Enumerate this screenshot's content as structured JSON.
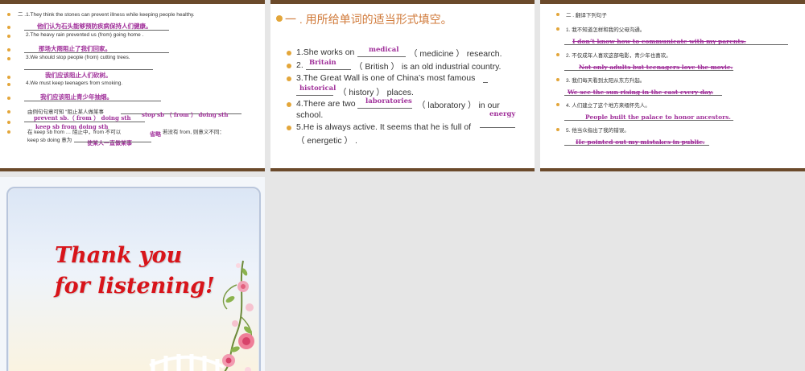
{
  "slide1": {
    "lines": [
      {
        "text": "二 .1.They think the stones can prevent illness while keeping people healthy.",
        "answer": "他们认为石头能够预防疾病保持人们健康。"
      },
      {
        "text": "2.The heavy rain prevented us (from) going home .",
        "answer": "那场大雨阻止了我们回家。"
      },
      {
        "text": "3.We should stop people (from) cutting trees.",
        "answer": "我们应该阻止人们砍树。"
      },
      {
        "text": "4.We must keep teenagers from smoking.",
        "answer": "我们应该阻止青少年抽烟。"
      }
    ],
    "note1": "由例句句意可知  “阻止某人做某事",
    "note1_ans_a": "prevent sb.（ from ）  doing sth",
    "note1_ans_b": "stop sb （ from ） doing sth",
    "note1_ans_c": "keep sb from doing sth",
    "note2": "在 keep sb from …  阻止中，from 不可以",
    "note2_ans": "省略",
    "note2_tail": "若没有 from, 则意义不同：",
    "note3": "keep sb doing  意为",
    "note3_ans": "使某人一直做某事"
  },
  "slide2": {
    "title": "一 . 用所给单词的适当形式填空。",
    "items": [
      {
        "before": "1.She works on",
        "answer": "medical",
        "after": "（ medicine ） research."
      },
      {
        "before": "2.",
        "answer": "Britain",
        "after": "（ British ） is an old industrial country."
      },
      {
        "before": "3.The Great Wall is one of China’s most famous",
        "answer": "historical",
        "after": "（ history ） places."
      },
      {
        "before": "4.There are two",
        "answer": "laboratories",
        "after": "（ laboratory ） in our",
        "after2": "school."
      },
      {
        "before": "5.He is always active. It seems that he is full of",
        "answer": "energy",
        "after": "（ energetic ）  ."
      }
    ]
  },
  "slide3": {
    "title": "二 . 翻译下列句子",
    "items": [
      {
        "q": "1. 我不知道怎样和我的父母沟通。",
        "a": "I don’t know how to communicate with my parents."
      },
      {
        "q": "2. 不仅成年人喜欢这部电影，青少年也喜欢。",
        "a": "Not only adults but teenagers love the movie."
      },
      {
        "q": "3.  我们每天看到太阳从东方升起。",
        "a": "We see the sun rising in the east every day."
      },
      {
        "q": "4. 人们建立了这个地方来缅怀先人。",
        "a": "People built the palace to honor ancestors."
      },
      {
        "q": "5. 他当众指出了我的错误。",
        "a": "He pointed out my mistakes in public."
      }
    ]
  },
  "slide4": {
    "line1": "Thank you",
    "line2": "for listening!"
  },
  "colors": {
    "answer": "#a0309a",
    "title": "#d07a3a",
    "bullet": "#e3a63a",
    "thanks": "#d8141a",
    "bar": "#6b4a2b"
  }
}
